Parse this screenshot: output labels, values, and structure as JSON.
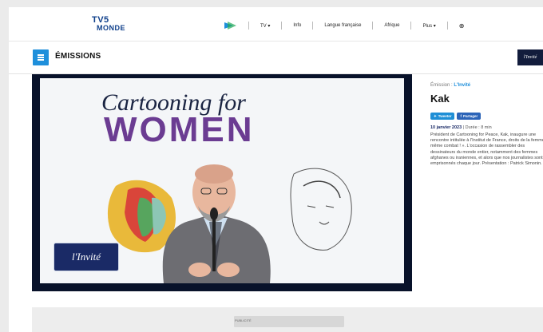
{
  "topnav": {
    "logo_line1": "TV5",
    "logo_line2": "MONDE",
    "items": [
      "TV ▾",
      "Info",
      "Langue française",
      "Afrique",
      "Plus ▾"
    ]
  },
  "section": {
    "title": "ÉMISSIONS",
    "brand_label": "l'Invité"
  },
  "video": {
    "slide_line1": "Cartooning for",
    "slide_line2": "WOMEN",
    "badge": "l'Invité"
  },
  "article": {
    "kicker_prefix": "Émission :",
    "kicker_category": "L'Invité",
    "title": "Kak",
    "share_twitter": "Tweeter",
    "share_facebook": "Partager",
    "date": "10 janvier 2023",
    "duration_label": "Durée : 8 min",
    "description": "Président de Cartooning for Peace, Kak, inaugure une rencontre intitulée à l'Institut de France, droits de la femme, même combat ! ». L'occasion de rassembler des dessinateurs du monde entier, notamment des femmes afghanes ou iraniennes, et alors que nos journalistes sont emprisonnés chaque jour. Présentation : Patrick Simonin."
  },
  "bottom": {
    "ad_label": "PUBLICITÉ"
  },
  "colors": {
    "accent": "#1e8fdb",
    "brand": "#0d3e8a",
    "purple": "#6b3c92"
  }
}
